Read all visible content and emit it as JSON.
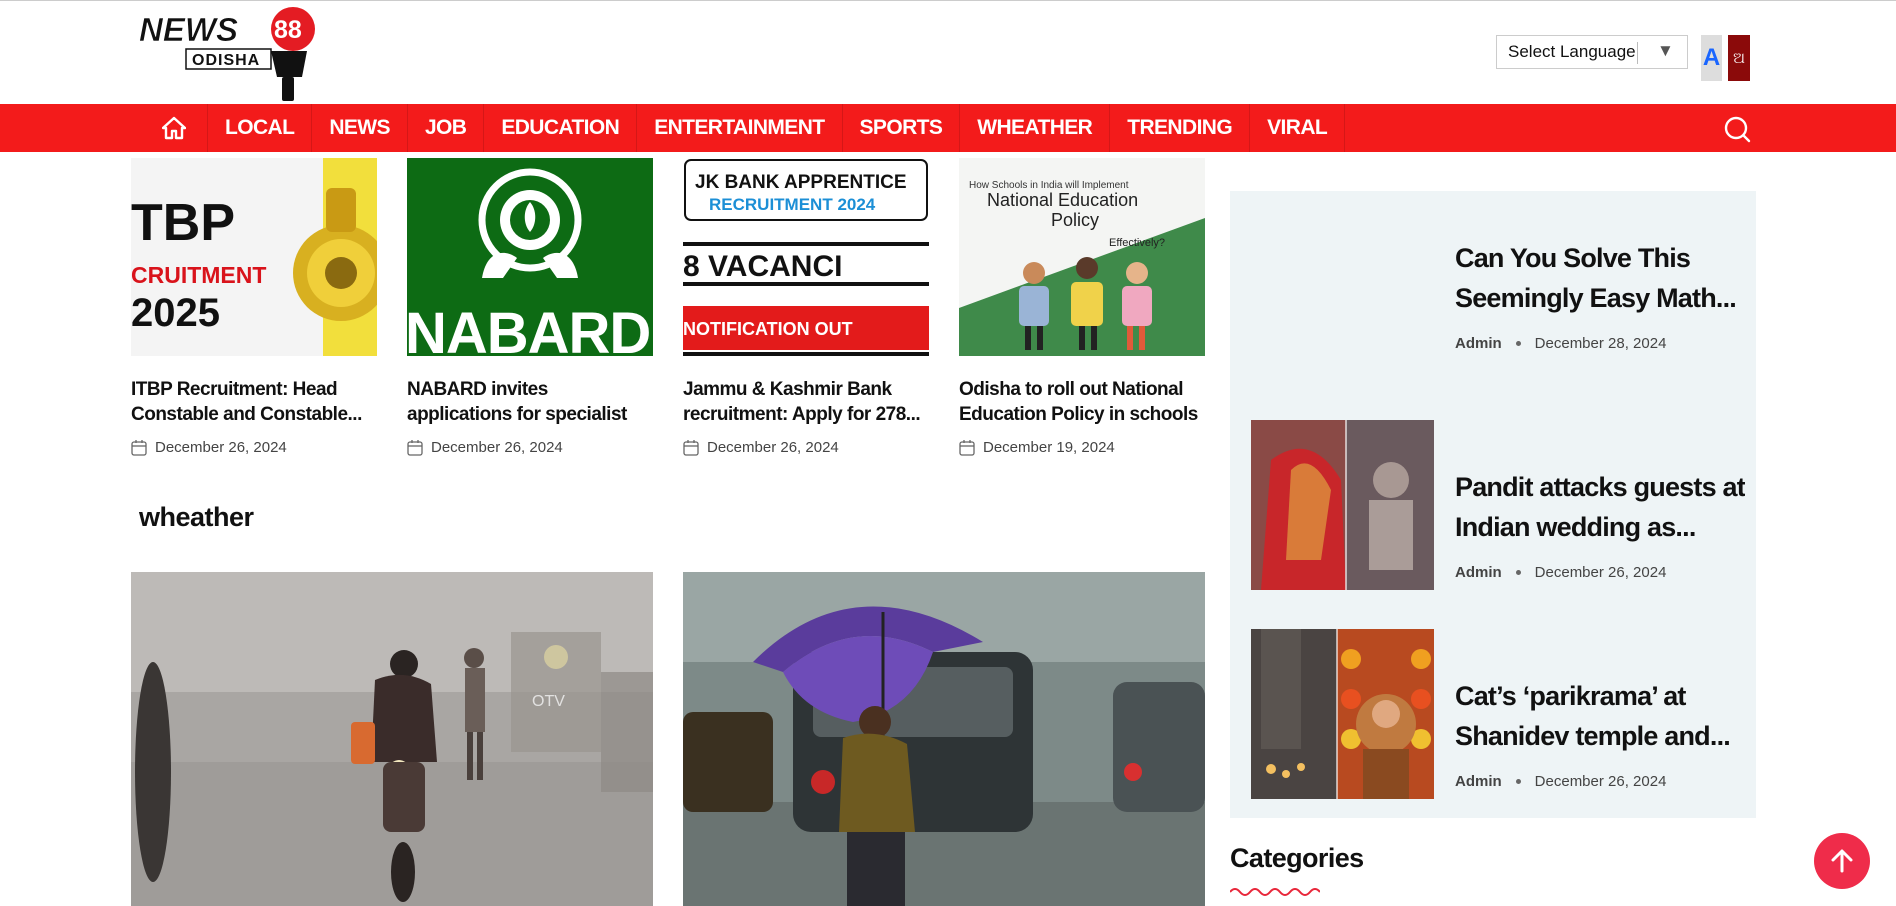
{
  "header": {
    "logo_text_main": "NEWS",
    "logo_text_num": "88",
    "logo_text_sub": "ODISHA",
    "language_select": "Select Language",
    "font_english": "A",
    "font_odia": "ଅ"
  },
  "nav": {
    "items": [
      "LOCAL",
      "NEWS",
      "JOB",
      "EDUCATION",
      "ENTERTAINMENT",
      "SPORTS",
      "WHEATHER",
      "TRENDING",
      "VIRAL"
    ]
  },
  "cards": [
    {
      "title": "ITBP Recruitment: Head Constable and Constable...",
      "date": "December 26, 2024",
      "thumb_text": [
        "TBP",
        "CRUITMENT",
        "2025"
      ]
    },
    {
      "title": "NABARD invites applications for specialist positions; chec...",
      "date": "December 26, 2024",
      "thumb_text": [
        "NABARD"
      ]
    },
    {
      "title": "Jammu & Kashmir Bank recruitment: Apply for 278...",
      "date": "December 26, 2024",
      "thumb_text": [
        "JK BANK APPRENTICE",
        "RECRUITMENT 2024",
        "8 VACANCI",
        "NOTIFICATION OUT"
      ]
    },
    {
      "title": "Odisha to roll out National Education Policy in schools ...",
      "date": "December 19, 2024",
      "thumb_text": [
        "How Schools in India will Implement",
        "National Education",
        "Policy",
        "Effectively?"
      ]
    }
  ],
  "section": {
    "title": "wheather",
    "fog_watermark": "OTV"
  },
  "sidebar": {
    "items": [
      {
        "title": "Can You Solve This Seemingly Easy Math...",
        "author": "Admin",
        "date": "December 28, 2024"
      },
      {
        "title": "Pandit attacks guests at Indian wedding as...",
        "author": "Admin",
        "date": "December 26, 2024"
      },
      {
        "title": "Cat’s ‘parikrama’ at Shanidev temple and...",
        "author": "Admin",
        "date": "December 26, 2024"
      }
    ],
    "categories_title": "Categories"
  },
  "colors": {
    "brand_red": "#f31b1b",
    "sidebar_bg": "#eef4f6",
    "scroll_top": "#ef2c4a"
  }
}
